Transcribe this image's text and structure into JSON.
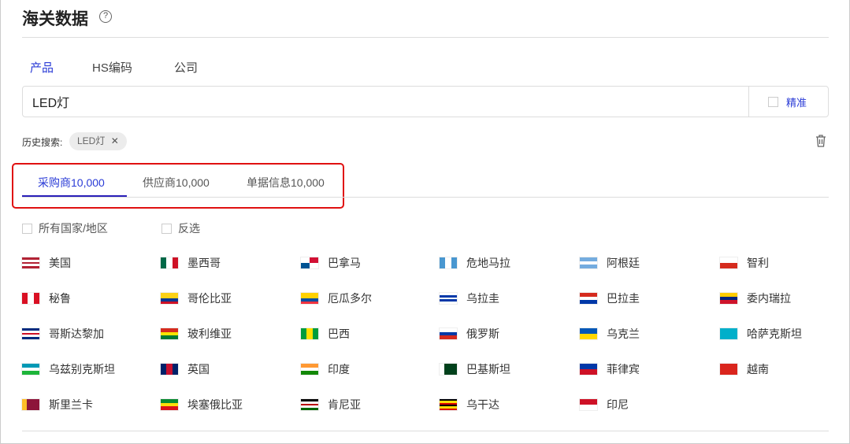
{
  "header": {
    "title": "海关数据",
    "help_icon": "?"
  },
  "search_tabs": [
    {
      "label": "产品",
      "active": true
    },
    {
      "label": "HS编码",
      "active": false
    },
    {
      "label": "公司",
      "active": false
    }
  ],
  "search": {
    "value": "LED灯",
    "precise_label": "精准"
  },
  "history": {
    "label": "历史搜索:",
    "chips": [
      "LED灯"
    ]
  },
  "result_tabs": [
    {
      "label": "采购商10,000",
      "active": true
    },
    {
      "label": "供应商10,000",
      "active": false
    },
    {
      "label": "单据信息10,000",
      "active": false
    }
  ],
  "filters": {
    "all_label": "所有国家/地区",
    "invert_label": "反选"
  },
  "countries": [
    {
      "name": "美国",
      "flag": [
        "#b22234",
        "#fff",
        "#b22234",
        "#fff",
        "#b22234"
      ],
      "dir": "v"
    },
    {
      "name": "墨西哥",
      "flag": [
        "#006847",
        "#fff",
        "#ce1126"
      ],
      "dir": "h"
    },
    {
      "name": "巴拿马",
      "flag": [
        "#fff",
        "#d21034",
        "#005293",
        "#fff"
      ],
      "dir": "q"
    },
    {
      "name": "危地马拉",
      "flag": [
        "#4997d0",
        "#fff",
        "#4997d0"
      ],
      "dir": "h"
    },
    {
      "name": "阿根廷",
      "flag": [
        "#74acdf",
        "#fff",
        "#74acdf"
      ],
      "dir": "v"
    },
    {
      "name": "智利",
      "flag": [
        "#fff",
        "#d52b1e"
      ],
      "dir": "v"
    },
    {
      "name": "秘鲁",
      "flag": [
        "#d91023",
        "#fff",
        "#d91023"
      ],
      "dir": "h"
    },
    {
      "name": "哥伦比亚",
      "flag": [
        "#fcd116",
        "#fcd116",
        "#003893",
        "#ce1126"
      ],
      "dir": "v"
    },
    {
      "name": "厄瓜多尔",
      "flag": [
        "#ffd100",
        "#ffd100",
        "#034ea2",
        "#ef3340"
      ],
      "dir": "v"
    },
    {
      "name": "乌拉圭",
      "flag": [
        "#fff",
        "#0038a8",
        "#fff",
        "#0038a8",
        "#fff"
      ],
      "dir": "v"
    },
    {
      "name": "巴拉圭",
      "flag": [
        "#d52b1e",
        "#fff",
        "#0038a8"
      ],
      "dir": "v"
    },
    {
      "name": "委内瑞拉",
      "flag": [
        "#ffcc00",
        "#00247d",
        "#cf142b"
      ],
      "dir": "v"
    },
    {
      "name": "哥斯达黎加",
      "flag": [
        "#002b7f",
        "#fff",
        "#ce1126",
        "#fff",
        "#002b7f"
      ],
      "dir": "v"
    },
    {
      "name": "玻利维亚",
      "flag": [
        "#d52b1e",
        "#f9e300",
        "#007934"
      ],
      "dir": "v"
    },
    {
      "name": "巴西",
      "flag": [
        "#009c3b",
        "#ffdf00",
        "#009c3b"
      ],
      "dir": "h"
    },
    {
      "name": "俄罗斯",
      "flag": [
        "#fff",
        "#0039a6",
        "#d52b1e"
      ],
      "dir": "v"
    },
    {
      "name": "乌克兰",
      "flag": [
        "#0057b7",
        "#ffd700"
      ],
      "dir": "v"
    },
    {
      "name": "哈萨克斯坦",
      "flag": [
        "#00afca"
      ],
      "dir": "v"
    },
    {
      "name": "乌兹别克斯坦",
      "flag": [
        "#0099b5",
        "#fff",
        "#1eb53a"
      ],
      "dir": "v"
    },
    {
      "name": "英国",
      "flag": [
        "#012169",
        "#c8102e",
        "#012169"
      ],
      "dir": "h"
    },
    {
      "name": "印度",
      "flag": [
        "#ff9933",
        "#fff",
        "#138808"
      ],
      "dir": "v"
    },
    {
      "name": "巴基斯坦",
      "flag": [
        "#fff",
        "#01411c",
        "#01411c",
        "#01411c"
      ],
      "dir": "h"
    },
    {
      "name": "菲律宾",
      "flag": [
        "#0038a8",
        "#ce1126"
      ],
      "dir": "v"
    },
    {
      "name": "越南",
      "flag": [
        "#da251d"
      ],
      "dir": "v"
    },
    {
      "name": "斯里兰卡",
      "flag": [
        "#ffbe29",
        "#8d153a",
        "#8d153a",
        "#8d153a"
      ],
      "dir": "h"
    },
    {
      "name": "埃塞俄比亚",
      "flag": [
        "#078930",
        "#fcdd09",
        "#da121a"
      ],
      "dir": "v"
    },
    {
      "name": "肯尼亚",
      "flag": [
        "#000",
        "#fff",
        "#bb0000",
        "#fff",
        "#006600"
      ],
      "dir": "v"
    },
    {
      "name": "乌干达",
      "flag": [
        "#000",
        "#fcdc04",
        "#d90000",
        "#000",
        "#fcdc04",
        "#d90000"
      ],
      "dir": "v"
    },
    {
      "name": "印尼",
      "flag": [
        "#ce1126",
        "#fff"
      ],
      "dir": "v"
    }
  ]
}
